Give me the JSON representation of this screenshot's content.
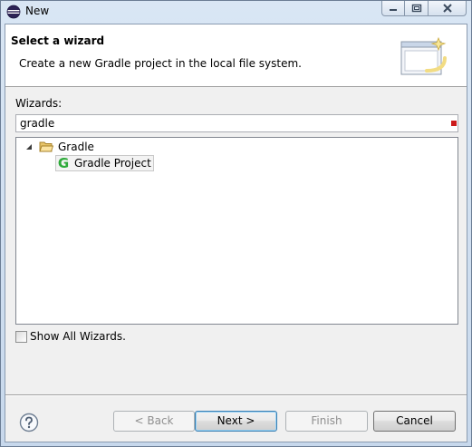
{
  "window": {
    "title": "New",
    "icon": "eclipse-icon"
  },
  "header": {
    "title": "Select a wizard",
    "description": "Create a new Gradle project in the local file system.",
    "banner_icon": "new-wizard-icon"
  },
  "filter": {
    "label": "Wizards:",
    "value": "gradle"
  },
  "tree": {
    "items": [
      {
        "label": "Gradle",
        "icon": "folder-icon",
        "expanded": true,
        "level": 0
      },
      {
        "label": "Gradle Project",
        "icon": "gradle-icon",
        "selected": true,
        "level": 1
      }
    ]
  },
  "options": {
    "show_all_wizards": "Show All Wizards.",
    "show_all_checked": false
  },
  "buttons": {
    "back": "< Back",
    "next": "Next >",
    "finish": "Finish",
    "cancel": "Cancel",
    "help_icon": "help-icon"
  },
  "colors": {
    "gradle_green": "#2eaa3a",
    "clear_indicator": "#cc1b1b",
    "default_button_border": "#3c7fb1"
  }
}
